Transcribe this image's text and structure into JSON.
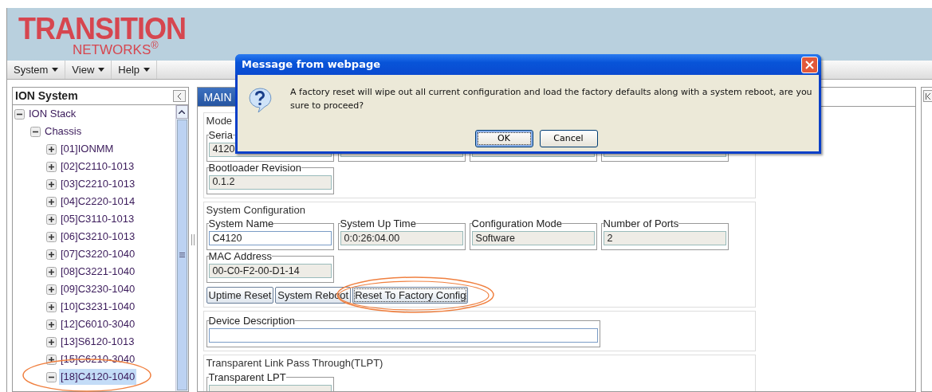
{
  "header": {
    "logo_text": "TRANSITION",
    "logo_subtext": "NETWORKS$^{®}$"
  },
  "menu": [
    {
      "label": "System"
    },
    {
      "label": "View"
    },
    {
      "label": "Help"
    }
  ],
  "sidebar": {
    "title": "ION System",
    "tree": [
      {
        "label": "ION Stack",
        "expanded": true,
        "selected": false,
        "children": [
          {
            "label": "Chassis",
            "expanded": true,
            "selected": false,
            "children": [
              {
                "label": "[01]IONMM",
                "expanded": false,
                "selected": false
              },
              {
                "label": "[02]C2110-1013",
                "expanded": false,
                "selected": false
              },
              {
                "label": "[03]C2210-1013",
                "expanded": false,
                "selected": false
              },
              {
                "label": "[04]C2220-1014",
                "expanded": false,
                "selected": false
              },
              {
                "label": "[05]C3110-1013",
                "expanded": false,
                "selected": false
              },
              {
                "label": "[06]C3210-1013",
                "expanded": false,
                "selected": false
              },
              {
                "label": "[07]C3220-1040",
                "expanded": false,
                "selected": false
              },
              {
                "label": "[08]C3221-1040",
                "expanded": false,
                "selected": false
              },
              {
                "label": "[09]C3230-1040",
                "expanded": false,
                "selected": false
              },
              {
                "label": "[10]C3231-1040",
                "expanded": false,
                "selected": false
              },
              {
                "label": "[12]C6010-3040",
                "expanded": false,
                "selected": false
              },
              {
                "label": "[13]S6120-1013",
                "expanded": false,
                "selected": false
              },
              {
                "label": "[15]C6210-3040",
                "expanded": false,
                "selected": false
              },
              {
                "label": "[18]C4120-1040",
                "expanded": true,
                "selected": true
              }
            ]
          }
        ]
      }
    ]
  },
  "main": {
    "tabs": [
      {
        "label": "MAIN",
        "selected": true
      }
    ],
    "groups": [
      {
        "legend": "Mode",
        "rows": [
          [
            {
              "label": "Seria",
              "value": "4120",
              "editable": false
            },
            {
              "kind": "covered"
            },
            {
              "kind": "covered"
            },
            {
              "kind": "covered"
            }
          ],
          [
            {
              "label": "Bootloader Revision",
              "value": "0.1.2",
              "editable": false
            }
          ]
        ]
      },
      {
        "legend": "System Configuration",
        "rows": [
          [
            {
              "label": "System Name",
              "value": "C4120",
              "editable": true
            },
            {
              "label": "System Up Time",
              "value": "0:0:26:04.00",
              "editable": false
            },
            {
              "label": "Configuration Mode",
              "value": "Software",
              "editable": false
            },
            {
              "label": "Number of Ports",
              "value": "2",
              "editable": false
            }
          ],
          [
            {
              "label": "MAC Address",
              "value": "00-C0-F2-00-D1-14",
              "editable": false
            }
          ]
        ],
        "buttons": [
          {
            "label": "Uptime Reset",
            "focused": false
          },
          {
            "label": "System Reboot",
            "focused": false
          },
          {
            "label": "Reset To Factory Config",
            "focused": true
          }
        ]
      },
      {
        "rows": [
          [
            {
              "label": "Device Description",
              "editable": true,
              "kind": "wide"
            }
          ]
        ]
      },
      {
        "legend": "Transparent Link Pass Through(TLPT)",
        "rows": [
          [
            {
              "label": "Transparent LPT",
              "kind": "covered"
            }
          ]
        ]
      }
    ]
  },
  "dialog": {
    "title": "Message from webpage",
    "message": "A factory reset will wipe out all current configuration and load the factory defaults along with a system reboot, are you sure to proceed?",
    "buttons": [
      {
        "label": "OK",
        "focused": true
      },
      {
        "label": "Cancel",
        "focused": false
      }
    ]
  }
}
